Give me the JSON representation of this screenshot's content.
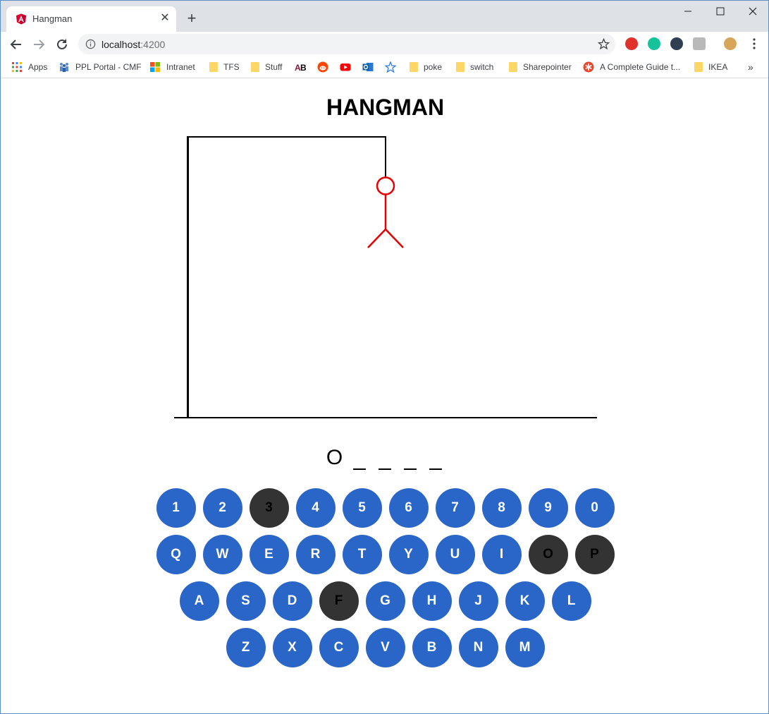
{
  "browser": {
    "tab_title": "Hangman",
    "url_host": "localhost",
    "url_port": ":4200",
    "bookmarks": [
      {
        "label": "Apps",
        "icon": "apps-grid-icon"
      },
      {
        "label": "PPL Portal - CMF",
        "icon": "people-icon"
      },
      {
        "label": "Intranet",
        "icon": "windows-logo-icon"
      },
      {
        "label": "TFS",
        "icon": "folder-icon"
      },
      {
        "label": "Stuff",
        "icon": "folder-icon"
      },
      {
        "label": "",
        "icon": "ab-icon"
      },
      {
        "label": "",
        "icon": "reddit-icon"
      },
      {
        "label": "",
        "icon": "youtube-icon"
      },
      {
        "label": "",
        "icon": "outlook-icon"
      },
      {
        "label": "",
        "icon": "star-bookmark-icon"
      },
      {
        "label": "poke",
        "icon": "folder-icon"
      },
      {
        "label": "switch",
        "icon": "folder-icon"
      },
      {
        "label": "Sharepointer",
        "icon": "folder-icon"
      },
      {
        "label": "A Complete Guide t...",
        "icon": "asterisk-logo-icon"
      },
      {
        "label": "IKEA",
        "icon": "folder-icon"
      }
    ],
    "more_bookmarks": "»"
  },
  "game": {
    "title": "HANGMAN",
    "word": [
      "O",
      "_",
      "_",
      "_",
      "_"
    ],
    "figure_color": "#e80000",
    "key_color": "#2a66c8",
    "used_key_color": "#333333",
    "rows": [
      [
        "1",
        "2",
        "3",
        "4",
        "5",
        "6",
        "7",
        "8",
        "9",
        "0"
      ],
      [
        "Q",
        "W",
        "E",
        "R",
        "T",
        "Y",
        "U",
        "I",
        "O",
        "P"
      ],
      [
        "A",
        "S",
        "D",
        "F",
        "G",
        "H",
        "J",
        "K",
        "L"
      ],
      [
        "Z",
        "X",
        "C",
        "V",
        "B",
        "N",
        "M"
      ]
    ],
    "used_keys": [
      "3",
      "O",
      "P",
      "F"
    ]
  }
}
